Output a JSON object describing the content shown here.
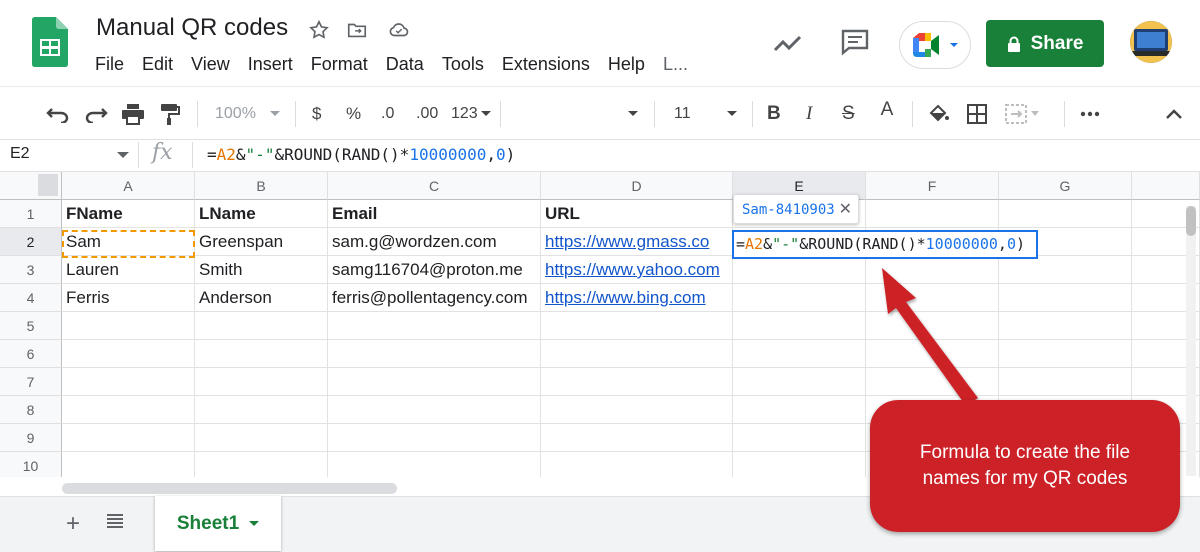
{
  "app": {
    "title": "Manual QR codes",
    "menu": [
      "File",
      "Edit",
      "View",
      "Insert",
      "Format",
      "Data",
      "Tools",
      "Extensions",
      "Help",
      "L..."
    ],
    "share_label": "Share",
    "colors": {
      "share": "#188038",
      "selection": "#1a73e8",
      "callout": "#cc2127",
      "link": "#1155cc"
    }
  },
  "toolbar": {
    "zoom": "100%",
    "currency": "$",
    "percent": "%",
    "decrease_decimals": ".0",
    "increase_decimals": ".00",
    "more_formats": "123",
    "font_size": "11",
    "bold": "B",
    "italic": "I",
    "strike": "S",
    "text_color": "A"
  },
  "formula_bar": {
    "name_box": "E2",
    "fx": "fx",
    "formula_parts": [
      {
        "text": "=",
        "kind": "plain"
      },
      {
        "text": "A2",
        "kind": "ref"
      },
      {
        "text": "&",
        "kind": "plain"
      },
      {
        "text": "\"-\"",
        "kind": "str"
      },
      {
        "text": "&ROUND(RAND()*",
        "kind": "plain"
      },
      {
        "text": "10000000",
        "kind": "num"
      },
      {
        "text": ",",
        "kind": "plain"
      },
      {
        "text": "0",
        "kind": "num"
      },
      {
        "text": ")",
        "kind": "plain"
      }
    ]
  },
  "sheet": {
    "columns": [
      "A",
      "B",
      "C",
      "D",
      "E",
      "F",
      "G"
    ],
    "rows": [
      "1",
      "2",
      "3",
      "4",
      "5",
      "6",
      "7",
      "8",
      "9",
      "10"
    ],
    "cells": [
      [
        "FName",
        "LName",
        "Email",
        "URL"
      ],
      [
        "Sam",
        "Greenspan",
        "sam.g@wordzen.com",
        "https://www.gmass.co"
      ],
      [
        "Lauren",
        "Smith",
        "samg116704@proton.me",
        "https://www.yahoo.com"
      ],
      [
        "Ferris",
        "Anderson",
        "ferris@pollentagency.com",
        "https://www.bing.com"
      ]
    ],
    "preview_tooltip": "Sam-8410903",
    "tab_label": "Sheet1"
  },
  "annotation": {
    "text": "Formula to create the file names for my QR codes"
  }
}
